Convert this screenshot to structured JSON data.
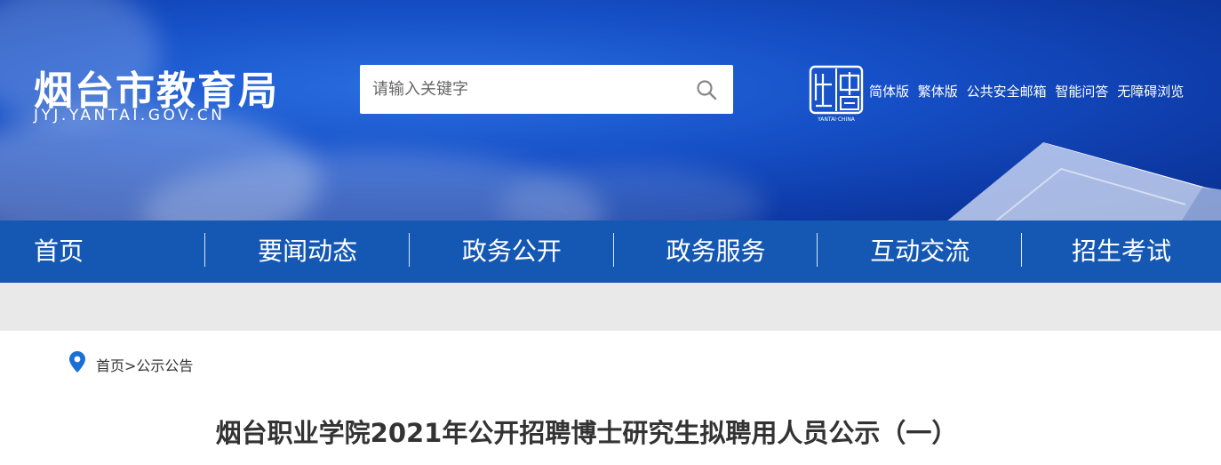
{
  "header": {
    "logo_title": "烟台市教育局",
    "logo_subtitle": "JYJ.YANTAI.GOV.CN",
    "search_placeholder": "请输入关键字",
    "seal_caption": "YANTAI·CHINA",
    "links": [
      "简体版",
      "繁体版",
      "公共安全邮箱",
      "智能问答",
      "无障碍浏览"
    ]
  },
  "nav": {
    "items": [
      "首页",
      "要闻动态",
      "政务公开",
      "政务服务",
      "互动交流",
      "招生考试"
    ]
  },
  "breadcrumb": {
    "home": "首页",
    "separator": ">",
    "current": "公示公告"
  },
  "article": {
    "title": "烟台职业学院2021年公开招聘博士研究生拟聘用人员公示（一）"
  },
  "colors": {
    "nav_bg": "#1558b4",
    "header_blue": "#1650c8",
    "band_gray": "#e9e9e9",
    "pin_blue": "#1a6fd6"
  }
}
